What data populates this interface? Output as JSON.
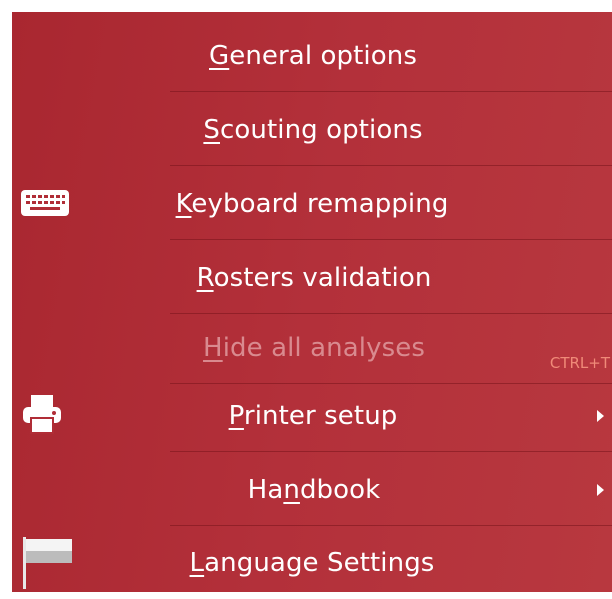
{
  "menu": {
    "items": [
      {
        "pre": "",
        "key": "G",
        "post": "eneral options",
        "disabled": false,
        "shortcut": "",
        "submenu": false,
        "icon": ""
      },
      {
        "pre": "",
        "key": "S",
        "post": "couting options",
        "disabled": false,
        "shortcut": "",
        "submenu": false,
        "icon": ""
      },
      {
        "pre": "",
        "key": "K",
        "post": "eyboard remapping",
        "disabled": false,
        "shortcut": "",
        "submenu": false,
        "icon": "keyboard-icon"
      },
      {
        "pre": "",
        "key": "R",
        "post": "osters validation",
        "disabled": false,
        "shortcut": "",
        "submenu": false,
        "icon": ""
      },
      {
        "pre": "",
        "key": "H",
        "post": "ide all analyses",
        "disabled": true,
        "shortcut": "CTRL+T",
        "submenu": false,
        "icon": ""
      },
      {
        "pre": "",
        "key": "P",
        "post": "rinter setup",
        "disabled": false,
        "shortcut": "",
        "submenu": true,
        "icon": "printer-icon"
      },
      {
        "pre": "Ha",
        "key": "n",
        "post": "dbook",
        "disabled": false,
        "shortcut": "",
        "submenu": true,
        "icon": ""
      },
      {
        "pre": "",
        "key": "L",
        "post": "anguage Settings",
        "disabled": false,
        "shortcut": "",
        "submenu": false,
        "icon": "flag-icon"
      }
    ]
  },
  "colors": {
    "menu_background": "#b02d36",
    "text": "#ffffff",
    "disabled_text": "#d98a8f",
    "shortcut_text": "#f08a78"
  }
}
